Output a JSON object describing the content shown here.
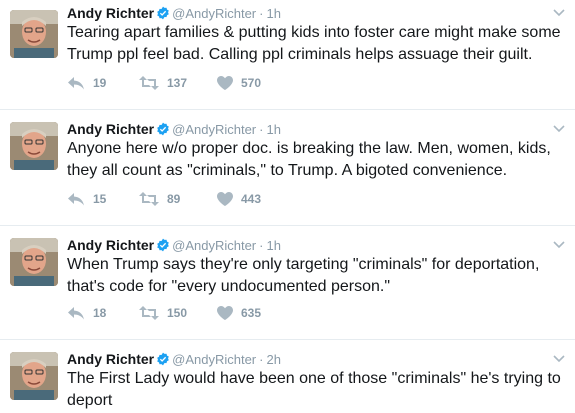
{
  "colors": {
    "text": "#14171a",
    "muted": "#8899a6",
    "verified": "#1da1f2",
    "divider": "#e6ecf0"
  },
  "icons": [
    "reply-icon",
    "retweet-icon",
    "like-icon",
    "verified-icon",
    "caret-down-icon"
  ],
  "tweets": [
    {
      "name": "Andy Richter",
      "handle": "@AndyRichter",
      "separator": "·",
      "time": "1h",
      "text": "Tearing apart families & putting kids into foster care might make some Trump ppl feel bad. Calling ppl criminals helps assuage their guilt.",
      "replies": "19",
      "retweets": "137",
      "likes": "570"
    },
    {
      "name": "Andy Richter",
      "handle": "@AndyRichter",
      "separator": "·",
      "time": "1h",
      "text": "Anyone here w/o proper doc. is breaking the law. Men, women, kids, they all count as \"criminals,\" to Trump. A bigoted convenience.",
      "replies": "15",
      "retweets": "89",
      "likes": "443"
    },
    {
      "name": "Andy Richter",
      "handle": "@AndyRichter",
      "separator": "·",
      "time": "1h",
      "text": "When Trump says they're only targeting \"criminals\" for deportation, that's code for \"every undocumented person.\"",
      "replies": "18",
      "retweets": "150",
      "likes": "635"
    },
    {
      "name": "Andy Richter",
      "handle": "@AndyRichter",
      "separator": "·",
      "time": "2h",
      "text": "The First Lady would have been one of those \"criminals\" he's trying to deport",
      "replies": "",
      "retweets": "",
      "likes": ""
    }
  ]
}
